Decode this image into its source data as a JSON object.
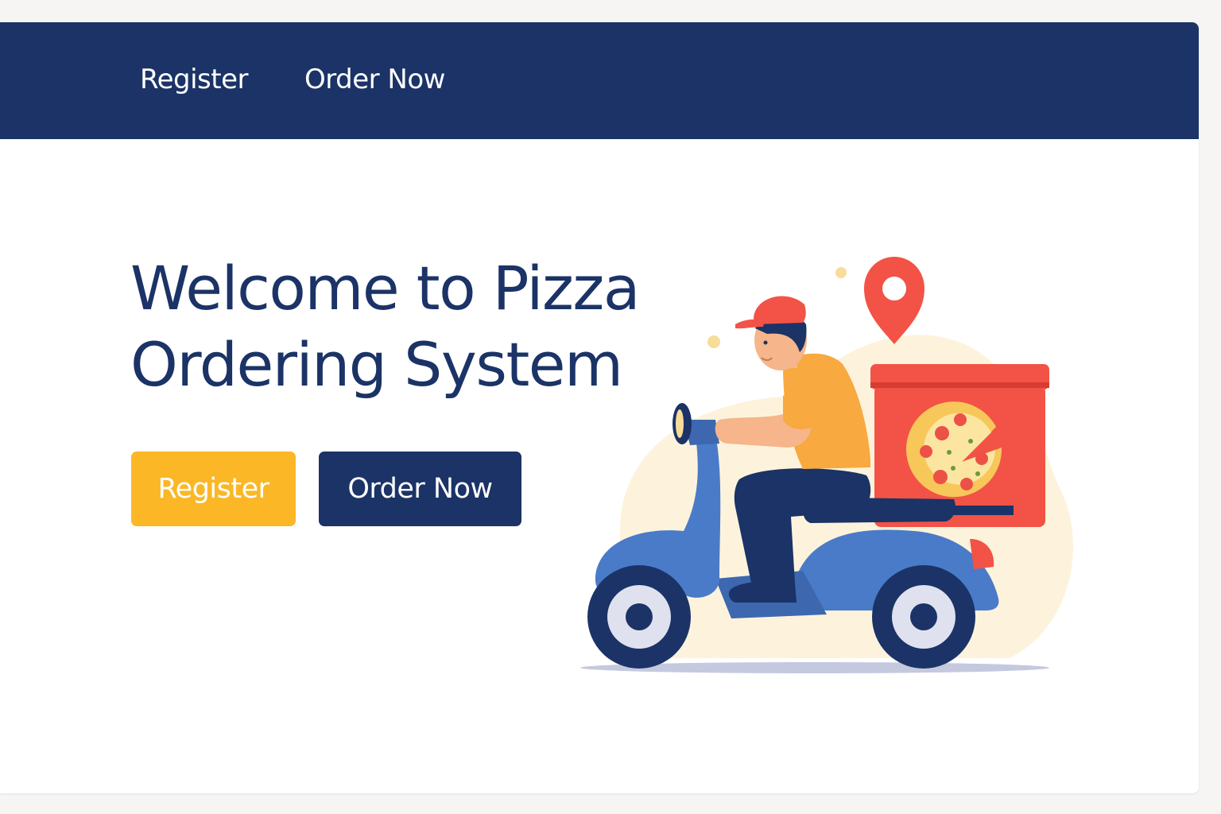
{
  "nav": {
    "items": [
      {
        "label": "Register"
      },
      {
        "label": "Order Now"
      }
    ]
  },
  "hero": {
    "title": "Welcome to Pizza Ordering System",
    "buttons": {
      "register_label": "Register",
      "order_label": "Order Now"
    }
  },
  "illustration": {
    "subject": "delivery-rider-on-scooter-with-pizza-box",
    "icons": [
      "location-pin-icon",
      "pizza-icon",
      "scooter-icon"
    ]
  },
  "colors": {
    "navbar": "#1b3366",
    "primary_text": "#1b3366",
    "accent_yellow": "#fbb726",
    "pizza_box_red": "#f25346",
    "scooter_blue": "#4a7bc8",
    "background": "#ffffff"
  }
}
